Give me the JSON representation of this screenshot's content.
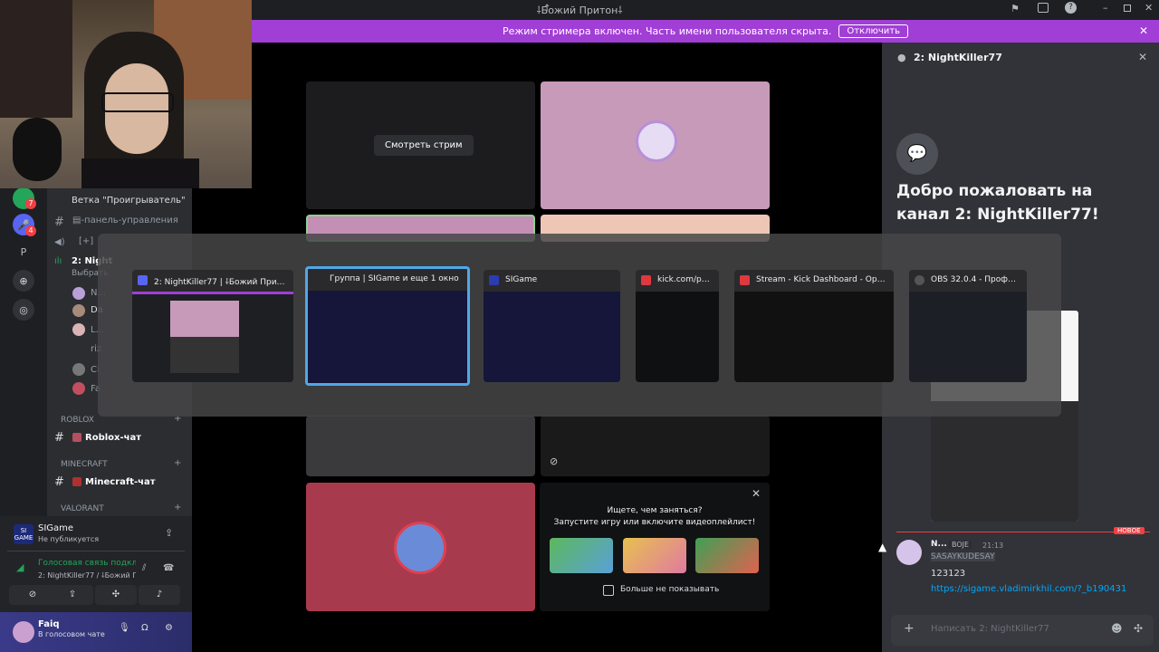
{
  "window": {
    "title": "⸸Божий Притон⸸"
  },
  "banner": {
    "text": "Режим стримера включен. Часть имени пользователя скрыта.",
    "button": "Отключить"
  },
  "servers": {
    "letter": "P",
    "badges": [
      "7",
      "4"
    ]
  },
  "channels": {
    "items": [
      {
        "label": "Ветка \"Проигрыватель\""
      },
      {
        "label": "▤-панель-управления"
      },
      {
        "label": "[+]"
      },
      {
        "label": "2: Night"
      },
      {
        "label": "Выбрать"
      }
    ],
    "voice_members": [
      "N...",
      "Da",
      "L...",
      "riz",
      "Ci",
      "Fa"
    ],
    "categories": [
      {
        "name": "ROBLOX",
        "channel": "Roblox-чат"
      },
      {
        "name": "MINECRAFT",
        "channel": "Minecraft-чат"
      },
      {
        "name": "VALORANT",
        "channel": ""
      }
    ]
  },
  "user_panel": {
    "sigame_title": "SIGame",
    "sigame_status": "Не публикуется",
    "voice_title": "Голосовая связь подкл",
    "voice_channel": "2: NightKiller77 / ⸸Божий Пр",
    "user_name": "Faiq",
    "user_status": "В голосовом чате"
  },
  "stage": {
    "watch_stream": "Смотреть стрим",
    "activity_title": "Ищете, чем заняться?",
    "activity_subtitle": "Запустите игру или включите видеоплейлист!",
    "dont_show": "Больше не показывать"
  },
  "chat": {
    "header": "2: NightKiller77",
    "welcome": "Добро пожаловать на канал 2: NightKiller77!",
    "new_badge": "НОВОЕ",
    "message": {
      "author": "N...",
      "tag": "BOJE",
      "time": "21:13",
      "lines": [
        "SASAYKUDESAY",
        "123123"
      ],
      "link": "https://sigame.vladimirkhil.com/?_b190431"
    },
    "input_placeholder": "Написать 2: NightKiller77"
  },
  "switcher": {
    "windows": [
      {
        "title": "2: NightKiller77 | ⸸Божий Притон⸸ - Dis...",
        "icon": "discord-icon"
      },
      {
        "title": "Группа | SIGame и еще 1 окно",
        "icon": "sigame-icon"
      },
      {
        "title": "SIGame",
        "icon": "sigame-icon"
      },
      {
        "title": "kick.com/popo...",
        "icon": "opera-icon"
      },
      {
        "title": "Stream - Kick Dashboard - Opera",
        "icon": "opera-icon"
      },
      {
        "title": "OBS 32.0.4 - Профиль: Бе...",
        "icon": "obs-icon"
      }
    ]
  },
  "colors": {
    "accent": "#a13ed6",
    "discord": "#5865f2",
    "green": "#23a55a",
    "red": "#f23f43",
    "link": "#00a8fc",
    "selection": "#4fa8e8"
  }
}
